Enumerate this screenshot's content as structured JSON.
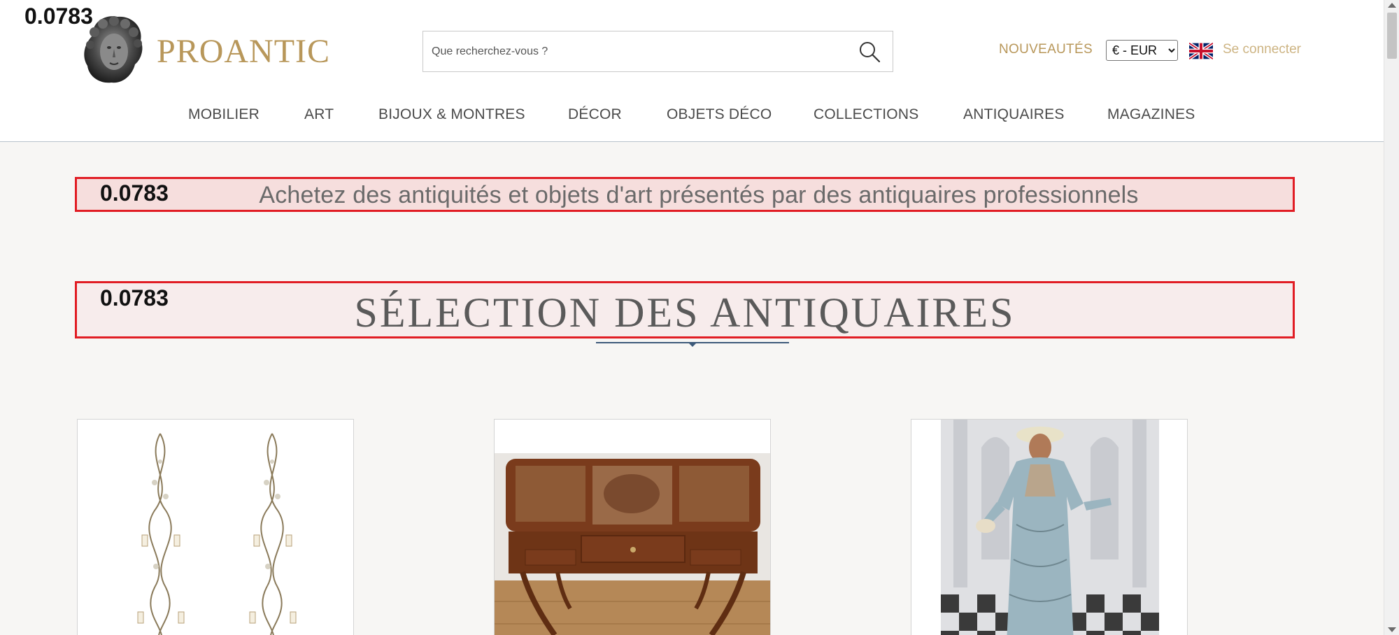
{
  "overlay": {
    "score": "0.0783"
  },
  "header": {
    "brand": "PROANTIC",
    "search": {
      "placeholder": "Que recherchez-vous ?",
      "value": ""
    },
    "nouveautes": "NOUVEAUTÉS",
    "currency": {
      "selected": "€ - EUR",
      "options": [
        "€ - EUR"
      ]
    },
    "language_flag": "uk-flag-icon",
    "connect": "Se connecter"
  },
  "nav": {
    "items": [
      {
        "label": "MOBILIER"
      },
      {
        "label": "ART"
      },
      {
        "label": "BIJOUX & MONTRES"
      },
      {
        "label": "DÉCOR"
      },
      {
        "label": "OBJETS DÉCO"
      },
      {
        "label": "COLLECTIONS"
      },
      {
        "label": "ANTIQUAIRES"
      },
      {
        "label": "MAGAZINES"
      }
    ]
  },
  "main": {
    "tagline": "Achetez des antiquités et objets d'art présentés par des antiquaires professionnels",
    "section_title": "SÉLECTION DES ANTIQUAIRES",
    "cards": [
      {
        "image": "chandelier-sconces-image"
      },
      {
        "image": "wooden-vanity-table-image"
      },
      {
        "image": "dressed-mannequin-figure-image"
      }
    ]
  },
  "colors": {
    "brand_gold": "#b8975a",
    "highlight_border": "#e11d24",
    "rule_blue": "#3d5a7a",
    "page_bg": "#f7f6f4"
  }
}
